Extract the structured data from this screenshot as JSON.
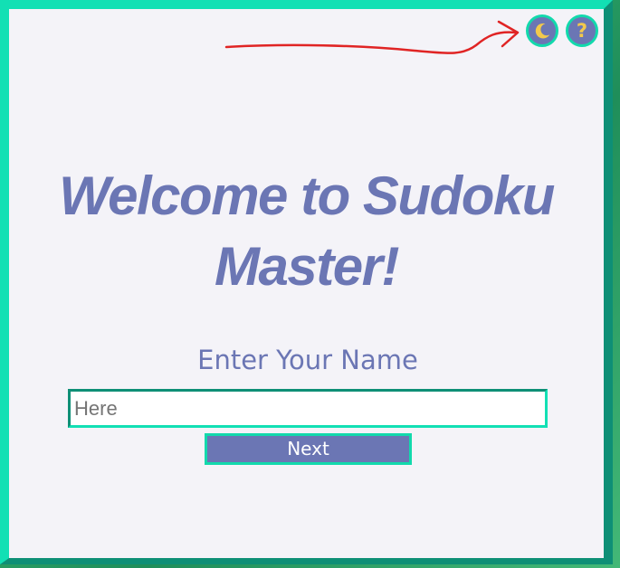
{
  "title": "Welcome to Sudoku Master!",
  "name_prompt": "Enter Your Name",
  "name_input": {
    "value": "",
    "placeholder": "Here"
  },
  "next_button": "Next",
  "toolbar": {
    "theme_icon": "moon-icon",
    "help_icon": "question-mark-icon",
    "help_glyph": "?"
  },
  "colors": {
    "accent": "#6b76b4",
    "border_light": "#12e0b4",
    "border_dark": "#0e8f76",
    "icon_fg": "#f2c94c",
    "annotation_arrow": "#e02424",
    "panel_bg": "#f4f3f8"
  }
}
